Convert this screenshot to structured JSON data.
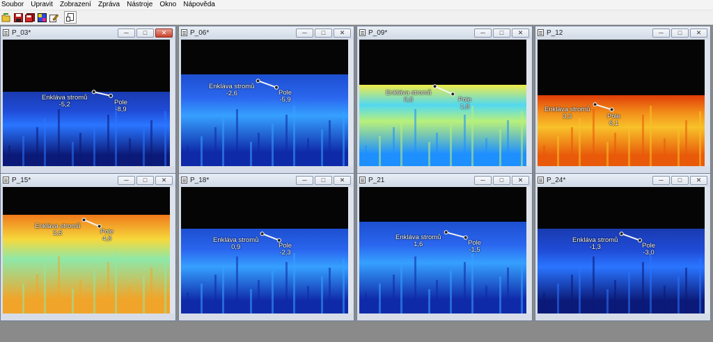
{
  "menu": [
    "Soubor",
    "Upravit",
    "Zobrazení",
    "Zpráva",
    "Nástroje",
    "Okno",
    "Nápověda"
  ],
  "toolbar": {
    "icons": [
      "open-folder-icon",
      "save-icon",
      "save-all-icon",
      "palette-icon",
      "edit-icon",
      "export-icon"
    ]
  },
  "windows": [
    {
      "title": "P_03*",
      "label_a": "Enkláva stromů",
      "value_a": "-5,2",
      "label_b": "Pole",
      "value_b": "-8,9",
      "palette": "cold"
    },
    {
      "title": "P_06*",
      "label_a": "Enkláva stromů",
      "value_a": "-2,6",
      "label_b": "Pole",
      "value_b": "-5,9",
      "palette": "cool"
    },
    {
      "title": "P_09*",
      "label_a": "Enkláva stromů",
      "value_a": "0,8",
      "label_b": "Pole",
      "value_b": "1,8",
      "palette": "mild"
    },
    {
      "title": "P_12",
      "label_a": "Enkláva stromů",
      "value_a": "3,3",
      "label_b": "Pole",
      "value_b": "6,1",
      "palette": "hot"
    },
    {
      "title": "P_15*",
      "label_a": "Enkláva stromů",
      "value_a": "3,6",
      "label_b": "Pole",
      "value_b": "4,8",
      "palette": "warm"
    },
    {
      "title": "P_18*",
      "label_a": "Enkláva stromů",
      "value_a": "0,9",
      "label_b": "Pole",
      "value_b": "-2,3",
      "palette": "cool"
    },
    {
      "title": "P_21",
      "label_a": "Enkláva stromů",
      "value_a": "1,6",
      "label_b": "Pole",
      "value_b": "-1,5",
      "palette": "cool"
    },
    {
      "title": "P_24*",
      "label_a": "Enkláva stromů",
      "value_a": "-1,3",
      "label_b": "Pole",
      "value_b": "-3,0",
      "palette": "cold"
    }
  ],
  "colors": {
    "cold": [
      "#0b1a78",
      "#1f4bd6",
      "#2a75ff",
      "#1a3bb0"
    ],
    "cool": [
      "#0f2aa8",
      "#2a66ee",
      "#36a0ff",
      "#1d4fd0"
    ],
    "mild": [
      "#1e8fff",
      "#52d8f0",
      "#b8f07a",
      "#f0ec4a"
    ],
    "hot": [
      "#e85a0a",
      "#f2901a",
      "#f8c12a",
      "#e03d08"
    ],
    "warm": [
      "#f0a52a",
      "#f6d83c",
      "#8ee8a8",
      "#f07a1a"
    ]
  }
}
